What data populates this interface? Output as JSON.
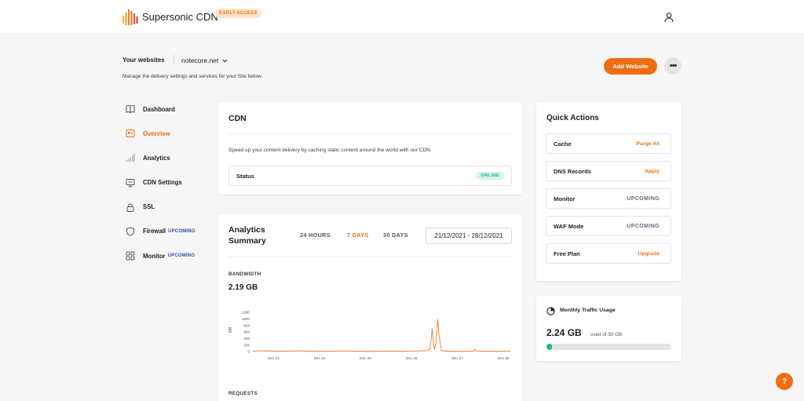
{
  "header": {
    "brand": "Supersonic CDN",
    "badge": "EARLY ACCESS"
  },
  "websites": {
    "label": "Your websites",
    "selected": "notecore.net",
    "description": "Manage the delivery settings and services for your Site below.",
    "add_button": "Add Website",
    "more_button": "•••"
  },
  "nav": {
    "items": [
      {
        "label": "Dashboard",
        "icon": "book-icon",
        "badge": ""
      },
      {
        "label": "Overview",
        "icon": "overview-icon",
        "badge": ""
      },
      {
        "label": "Analytics",
        "icon": "bar-chart-icon",
        "badge": ""
      },
      {
        "label": "CDN Settings",
        "icon": "monitor-icon",
        "badge": ""
      },
      {
        "label": "SSL",
        "icon": "lock-icon",
        "badge": ""
      },
      {
        "label": "Firewall",
        "icon": "shield-icon",
        "badge": "UPCOMING"
      },
      {
        "label": "Monitor",
        "icon": "grid-icon",
        "badge": "UPCOMING"
      }
    ],
    "active_index": 1
  },
  "cdn": {
    "title": "CDN",
    "description": "Speed up your content delivery by caching static content around the world with our CDN.",
    "status_label": "Status",
    "status_value": "ONLINE"
  },
  "analytics": {
    "title": "Analytics Summary",
    "tabs": [
      "24 HOURS",
      "7 DAYS",
      "30 DAYS"
    ],
    "active_tab": 1,
    "date_range": "21/12/2021 - 28/12/2021",
    "bandwidth_label": "BANDWIDTH",
    "bandwidth_value": "2.19 GB",
    "requests_label": "REQUESTS"
  },
  "chart_data": {
    "type": "line",
    "title": "",
    "xlabel": "",
    "ylabel": "MB",
    "x_ticks": [
      "Dec 23",
      "Dec 24",
      "Dec 25",
      "Dec 26",
      "Dec 27",
      "Dec 28"
    ],
    "y_ticks": [
      0,
      200,
      400,
      600,
      800,
      1000,
      1200
    ],
    "ylim": [
      0,
      1200
    ],
    "color": "#f07d24",
    "series": [
      {
        "name": "",
        "x": [
          0,
          0.1,
          0.2,
          0.3,
          0.4,
          0.5,
          0.6,
          0.7,
          0.8,
          0.9,
          1.0,
          1.2,
          1.4,
          1.6,
          1.8,
          2.0,
          2.2,
          2.4,
          2.6,
          2.8,
          3.0,
          3.2,
          3.4,
          3.6,
          3.8,
          3.85,
          3.88,
          3.9,
          3.92,
          3.95,
          3.98,
          4.02,
          4.05,
          4.1,
          4.2,
          4.4,
          4.6,
          4.8,
          4.82,
          4.85,
          5.0,
          5.2,
          5.4,
          5.6
        ],
        "y": [
          15,
          22,
          18,
          25,
          20,
          12,
          18,
          14,
          20,
          16,
          22,
          12,
          18,
          10,
          15,
          20,
          12,
          14,
          18,
          10,
          16,
          12,
          14,
          20,
          30,
          80,
          400,
          700,
          380,
          60,
          250,
          980,
          500,
          40,
          12,
          15,
          10,
          18,
          80,
          20,
          15,
          12,
          14,
          10
        ]
      }
    ]
  },
  "quick_actions": {
    "title": "Quick Actions",
    "rows": [
      {
        "label": "Cache",
        "action": "Purge All",
        "muted": false
      },
      {
        "label": "DNS Records",
        "action": "Apply",
        "muted": false
      },
      {
        "label": "Monitor",
        "action": "UPCOMING",
        "muted": true
      },
      {
        "label": "WAF Mode",
        "action": "UPCOMING",
        "muted": true
      },
      {
        "label": "Free Plan",
        "action": "Upgrade",
        "muted": false
      }
    ]
  },
  "traffic": {
    "title": "Monthly Traffic Usage",
    "value": "2.24 GB",
    "sub": "used of 50 GB",
    "fraction": 0.045
  },
  "help": {
    "label": "?"
  },
  "colors": {
    "accent": "#f06d12",
    "success": "#1ab394",
    "upcoming": "#2f4fa8"
  }
}
